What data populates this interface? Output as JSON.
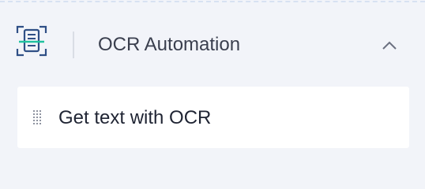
{
  "section": {
    "title": "OCR Automation",
    "icon": "ocr-scan-icon",
    "toggle_icon": "chevron-up-icon",
    "expanded": true,
    "accent_color": "#2f4f86",
    "scan_line_color": "#20c2a0"
  },
  "actions": [
    {
      "label": "Get text with OCR",
      "handle_icon": "drag-handle-icon"
    }
  ]
}
